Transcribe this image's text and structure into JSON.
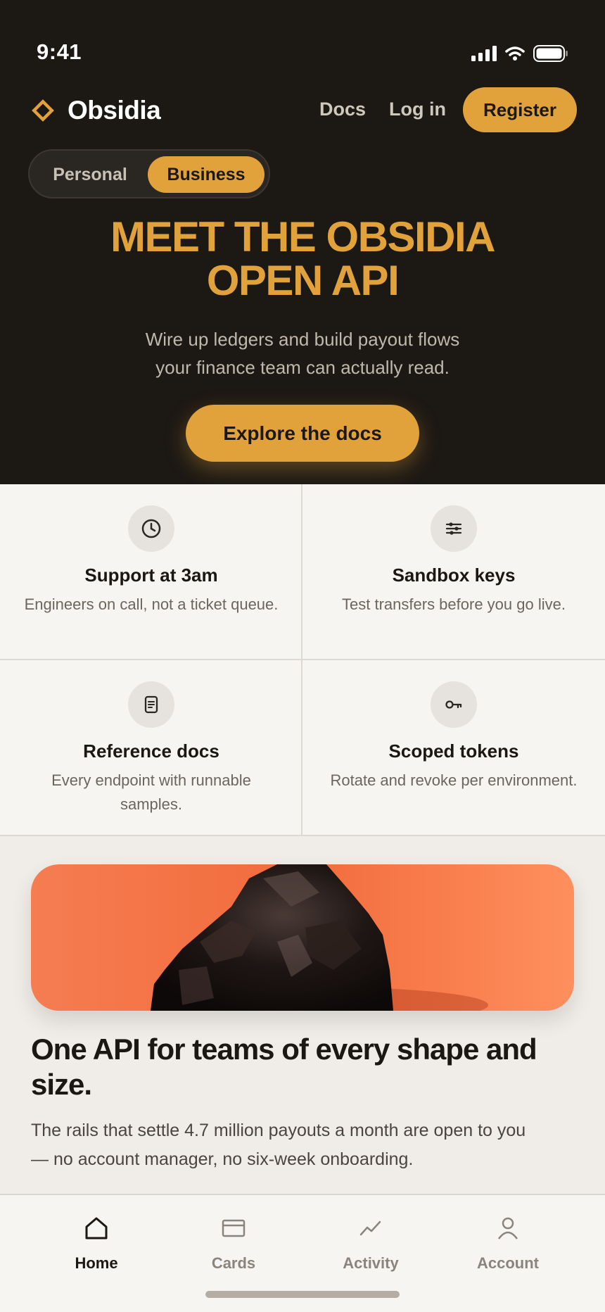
{
  "status_bar": {
    "time": "9:41"
  },
  "header": {
    "brand": "Obsidia",
    "nav": {
      "docs": "Docs",
      "login": "Log in",
      "register": "Register"
    }
  },
  "segment": {
    "options": [
      "Personal",
      "Business"
    ],
    "selected": "Business"
  },
  "hero": {
    "title_line1": "MEET THE OBSIDIA",
    "title_line2": "OPEN API",
    "subtitle_line1": "Wire up ledgers and build payout flows",
    "subtitle_line2": "your finance team can actually read.",
    "cta": "Explore the docs"
  },
  "features": [
    {
      "icon": "clock-icon",
      "title": "Support at 3am",
      "desc": "Engineers on call, not a ticket queue."
    },
    {
      "icon": "sliders-icon",
      "title": "Sandbox keys",
      "desc": "Test transfers before you go live."
    },
    {
      "icon": "document-icon",
      "title": "Reference docs",
      "desc": "Every endpoint with runnable samples."
    },
    {
      "icon": "key-icon",
      "title": "Scoped tokens",
      "desc": "Rotate and revoke per environment."
    }
  ],
  "section": {
    "title": "One API for teams of every shape and size.",
    "body": "The rails that settle 4.7 million payouts a month are open to you — no account manager, no six-week onboarding."
  },
  "tabbar": {
    "items": [
      {
        "label": "Home",
        "icon": "home-icon",
        "active": true
      },
      {
        "label": "Cards",
        "icon": "card-icon",
        "active": false
      },
      {
        "label": "Activity",
        "icon": "activity-icon",
        "active": false
      },
      {
        "label": "Account",
        "icon": "user-icon",
        "active": false
      }
    ]
  },
  "colors": {
    "accent": "#e1a23c",
    "hero_bg": "#1c1814",
    "surface": "#f7f5f1"
  }
}
